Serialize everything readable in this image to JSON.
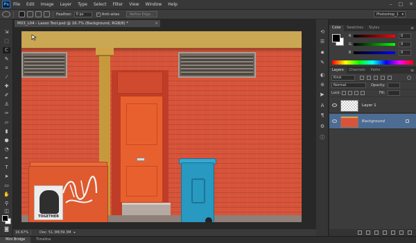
{
  "app": {
    "logo": "Ps"
  },
  "menu": [
    "File",
    "Edit",
    "Image",
    "Layer",
    "Type",
    "Select",
    "Filter",
    "View",
    "Window",
    "Help"
  ],
  "window_controls": [
    "–",
    "□",
    "✕"
  ],
  "options": {
    "feather_label": "Feather:",
    "feather_value": "0 px",
    "anti_alias_label": "Anti-alias",
    "anti_alias_checked": "✓",
    "refine_edge_label": "Refine Edge...",
    "workspace": "Photoshop_1"
  },
  "document": {
    "tab_title": "M03_L04 - Lasso Tool.psd @ 16.7% (Background, RGB/8) *",
    "tab_close": "×",
    "zoom": "16.67%",
    "doc_size": "Doc: 51.3M/39.3M",
    "status_arrow": "▸"
  },
  "bottom_tabs": [
    "Mini Bridge",
    "Timeline"
  ],
  "color_panel": {
    "tabs": [
      "Color",
      "Swatches",
      "Styles"
    ],
    "sliders": [
      {
        "label": "R",
        "value": "0",
        "gradient": "linear-gradient(90deg,#000,#ff0000)"
      },
      {
        "label": "G",
        "value": "0",
        "gradient": "linear-gradient(90deg,#000,#00ff00)"
      },
      {
        "label": "B",
        "value": "0",
        "gradient": "linear-gradient(90deg,#000,#0000ff)"
      }
    ],
    "foreground_color": "#000000",
    "background_color": "#ffffff"
  },
  "layers_panel": {
    "tabs": [
      "Layers",
      "Channels",
      "Paths"
    ],
    "filter_label": "Kind",
    "blend_mode": "Normal",
    "opacity_label": "Opacity:",
    "opacity_value": "",
    "lock_label": "Lock:",
    "fill_label": "Fill:",
    "fill_value": "",
    "layers": [
      {
        "name": "Layer 1",
        "selected": false,
        "italic": false,
        "locked": false
      },
      {
        "name": "Background",
        "selected": true,
        "italic": true,
        "locked": true
      }
    ],
    "footer_icons": [
      "link",
      "fx",
      "mask",
      "adjustment",
      "folder",
      "new",
      "trash"
    ]
  },
  "panel_menu_icon": "≡",
  "photo_graffiti_poster_text": "TOGETHER",
  "colors": {
    "accent_selected_layer": "#4c6c93",
    "brick": "#d7543a",
    "door": "#e9602f",
    "blue_bin": "#2899c0"
  }
}
